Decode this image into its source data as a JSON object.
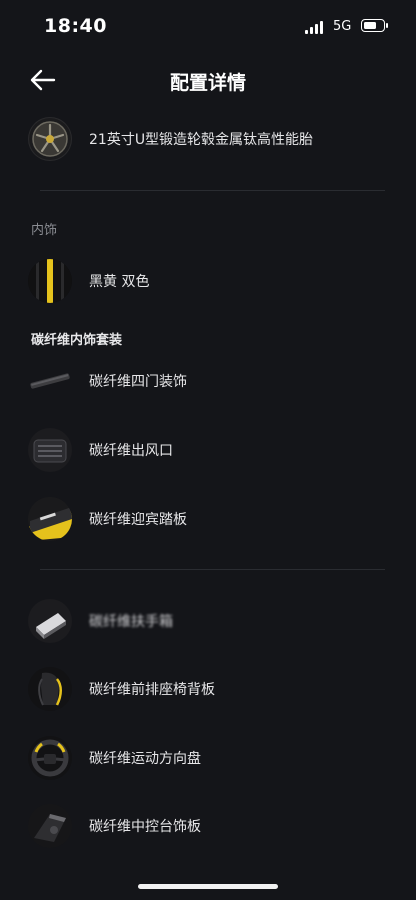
{
  "status": {
    "time": "18:40",
    "network": "5G",
    "battery_level": 0.7
  },
  "header": {
    "title": "配置详情"
  },
  "wheel": {
    "label": "21英寸U型锻造轮毂金属钛高性能胎"
  },
  "interior": {
    "section_label": "内饰",
    "color": {
      "label": "黑黄 双色"
    }
  },
  "carbon_kit": {
    "title": "碳纤维内饰套装",
    "items": [
      {
        "label": "碳纤维四门装饰"
      },
      {
        "label": "碳纤维出风口"
      },
      {
        "label": "碳纤维迎宾踏板"
      }
    ]
  },
  "more_items": [
    {
      "label": "碳纤维扶手箱"
    },
    {
      "label": "碳纤维前排座椅背板"
    },
    {
      "label": "碳纤维运动方向盘"
    },
    {
      "label": "碳纤维中控台饰板"
    }
  ],
  "colors": {
    "background": "#141519",
    "accent": "#e5c21c",
    "text": "#e6e6e8",
    "muted": "#8a8c92"
  }
}
